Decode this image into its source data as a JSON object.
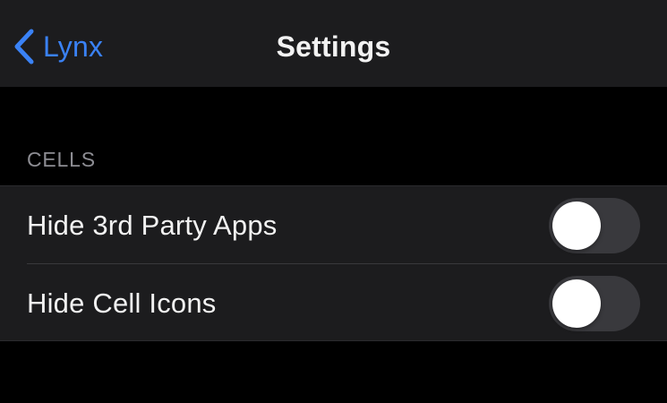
{
  "navbar": {
    "back_label": "Lynx",
    "title": "Settings"
  },
  "icons": {
    "back": "chevron-left-icon"
  },
  "colors": {
    "accent": "#3a82f6",
    "background": "#000000",
    "group_background": "#1c1c1e",
    "toggle_off": "#39393d"
  },
  "section": {
    "header": "CELLS",
    "rows": [
      {
        "label": "Hide 3rd Party Apps",
        "enabled": false
      },
      {
        "label": "Hide Cell Icons",
        "enabled": false
      }
    ]
  }
}
